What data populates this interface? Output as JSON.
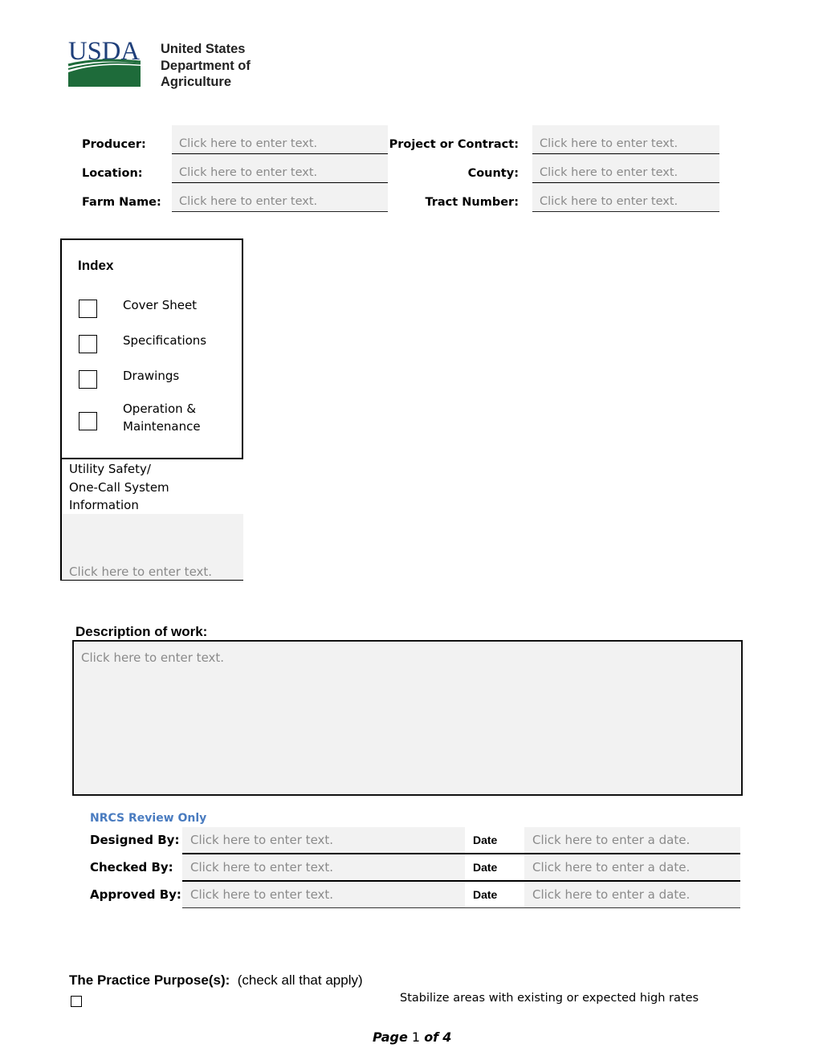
{
  "logo": {
    "mark_text": "USDA",
    "name_lines": [
      "United States",
      "Department of",
      "Agriculture"
    ],
    "colors": {
      "blue": "#1f3f7a",
      "green": "#1e6b3a"
    }
  },
  "header_fields": {
    "left": [
      {
        "label": "Producer:",
        "placeholder": "Click here to enter text."
      },
      {
        "label": "Location:",
        "placeholder": "Click here to enter text."
      },
      {
        "label": "Farm Name:",
        "placeholder": "Click here to enter text."
      }
    ],
    "right": [
      {
        "label": "Project or Contract:",
        "placeholder": "Click here to enter text."
      },
      {
        "label": "County:",
        "placeholder": "Click here to enter text."
      },
      {
        "label": "Tract Number:",
        "placeholder": "Click here to enter text."
      }
    ]
  },
  "index": {
    "title": "Index",
    "items": [
      {
        "label": "Cover Sheet",
        "checked": false
      },
      {
        "label": "Specifications",
        "checked": false
      },
      {
        "label": "Drawings",
        "checked": false
      },
      {
        "label_lines": [
          "Operation &",
          "Maintenance"
        ],
        "checked": false
      }
    ]
  },
  "utility": {
    "label_lines": [
      "Utility Safety/",
      "One-Call System",
      "Information"
    ],
    "placeholder": "Click here to enter text."
  },
  "description": {
    "title": "Description of work:",
    "placeholder": "Click here to enter text."
  },
  "nrcs_review": {
    "title": "NRCS Review Only",
    "title_color": "#4a7cc0",
    "rows": [
      {
        "label": "Designed By:",
        "placeholder": "Click here to enter text.",
        "date_label": "Date",
        "date_placeholder": "Click here to enter a date."
      },
      {
        "label": "Checked By:",
        "placeholder": "Click here to enter text.",
        "date_label": "Date",
        "date_placeholder": "Click here to enter a date."
      },
      {
        "label": "Approved By:",
        "placeholder": "Click here to enter text.",
        "date_label": "Date",
        "date_placeholder": "Click here to enter a date."
      }
    ]
  },
  "purpose": {
    "title": "The Practice Purpose(s):",
    "note": "(check all that apply)",
    "items": [
      {
        "label": "Stabilize areas with existing or expected high rates",
        "checked": false
      }
    ]
  },
  "footer": {
    "page_word": "Page",
    "current_page": "1",
    "of_word": "of",
    "total_pages": "4"
  }
}
